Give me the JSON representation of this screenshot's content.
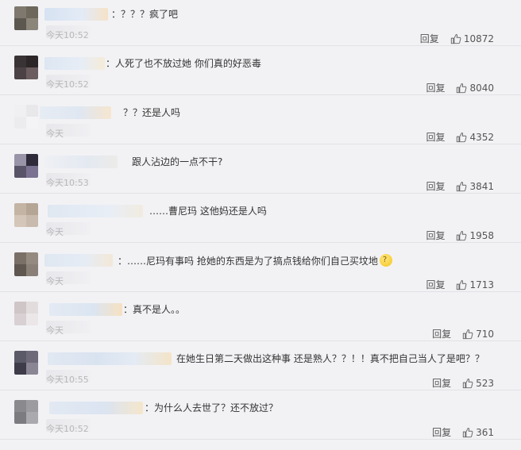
{
  "comments": [
    {
      "text": "：？？？疯了吧",
      "time": "今天10:52",
      "reply": "回复",
      "likes": "10872"
    },
    {
      "text": "：人死了也不放过她 你们真的好恶毒",
      "time": "今天10:52",
      "reply": "回复",
      "likes": "8040"
    },
    {
      "text": "？？还是人吗",
      "time": "今天",
      "reply": "回复",
      "likes": "4352"
    },
    {
      "text": "跟人沾边的一点不干?",
      "time": "今天10:53",
      "reply": "回复",
      "likes": "3841"
    },
    {
      "text": "……曹尼玛 这他妈还是人吗",
      "time": "今天",
      "reply": "回复",
      "likes": "1958"
    },
    {
      "text": "：……尼玛有事吗 抢她的东西是为了搞点钱给你们自己买坟地",
      "time": "今天",
      "reply": "回复",
      "likes": "1713",
      "emoji": "thinking-face"
    },
    {
      "text": "：真不是人。。",
      "time": "今天",
      "reply": "回复",
      "likes": "710"
    },
    {
      "text": "在她生日第二天做出这种事 还是熟人？？！！真不把自己当人了是吧？？",
      "time": "今天10:55",
      "reply": "回复",
      "likes": "523"
    },
    {
      "text": "：为什么人去世了？还不放过？",
      "time": "今天10:52",
      "reply": "回复",
      "likes": "361"
    }
  ],
  "icons": {
    "like": "thumbs-up-icon"
  }
}
